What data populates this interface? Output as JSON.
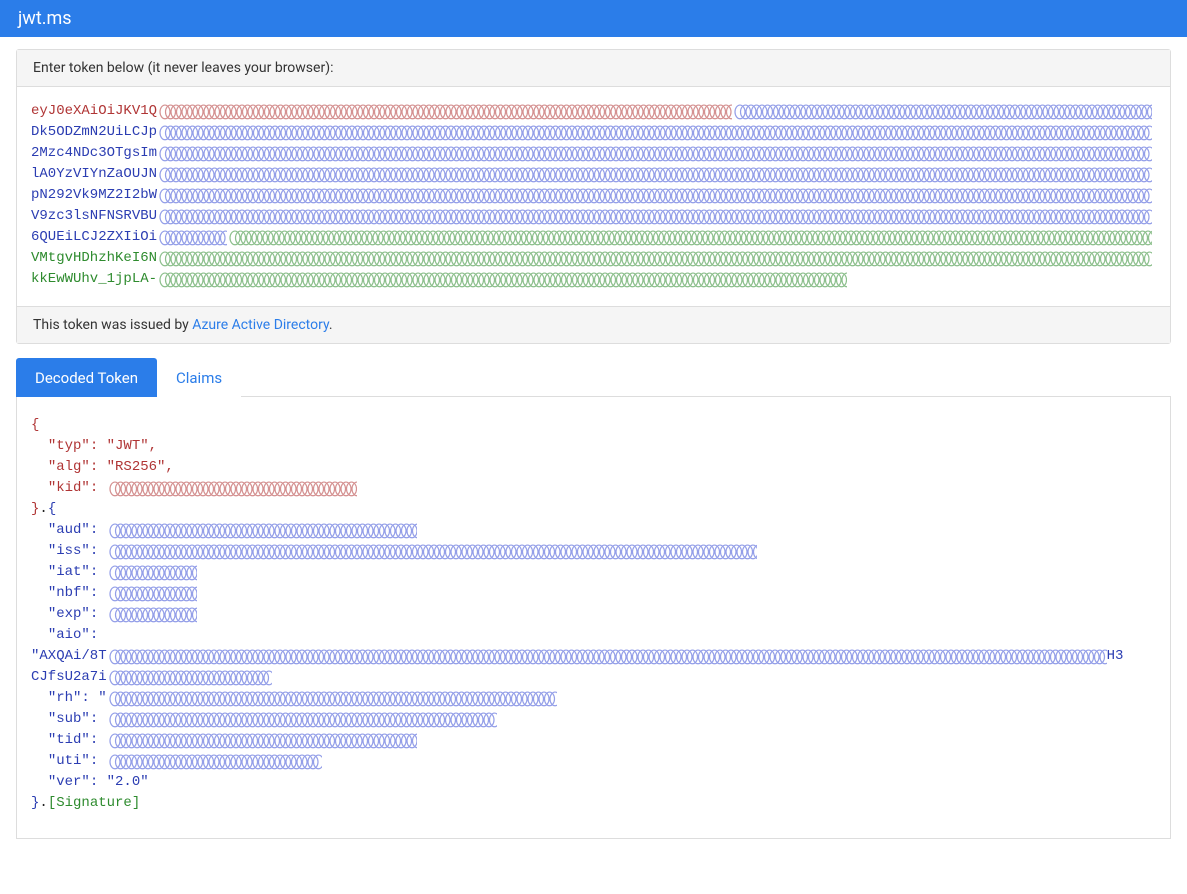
{
  "header": {
    "title": "jwt.ms"
  },
  "input_panel": {
    "label": "Enter token below (it never leaves your browser):"
  },
  "token_lines": [
    {
      "prefix": "eyJ0eXAiOiJKV1Q",
      "prefix_color": "red",
      "overlay_width": 575,
      "overlay_color": "red",
      "tail_width": 420,
      "tail_color": "blue"
    },
    {
      "prefix": "Dk5ODZmN2UiLCJp",
      "prefix_color": "blue",
      "overlay_width": 995,
      "overlay_color": "blue"
    },
    {
      "prefix": "2Mzc4NDc3OTgsIm",
      "prefix_color": "blue",
      "overlay_width": 995,
      "overlay_color": "blue"
    },
    {
      "prefix": "lA0YzVIYnZaOUJN",
      "prefix_color": "blue",
      "overlay_width": 995,
      "overlay_color": "blue"
    },
    {
      "prefix": "pN292Vk9MZ2I2bW",
      "prefix_color": "blue",
      "overlay_width": 995,
      "overlay_color": "blue"
    },
    {
      "prefix": "V9zc3lsNFNSRVBU",
      "prefix_color": "blue",
      "overlay_width": 995,
      "overlay_color": "blue"
    },
    {
      "prefix": "6QUEiLCJ2ZXIiOi",
      "prefix_color": "blue",
      "overlay_width": 70,
      "overlay_color": "blue",
      "tail_width": 925,
      "tail_color": "green"
    },
    {
      "prefix": "VMtgvHDhzhKeI6N",
      "prefix_color": "green",
      "overlay_width": 995,
      "overlay_color": "green"
    },
    {
      "prefix": "kkEwWUhv_1jpLA-",
      "prefix_color": "green",
      "overlay_width": 690,
      "overlay_color": "green"
    }
  ],
  "issuer": {
    "prefix": "This token was issued by ",
    "link_text": "Azure Active Directory",
    "suffix": "."
  },
  "tabs": {
    "decoded": "Decoded Token",
    "claims": "Claims",
    "active": "decoded"
  },
  "decoded": {
    "open_brace": "{",
    "header_lines": [
      {
        "key": "typ",
        "value": "\"JWT\",",
        "redacted": false
      },
      {
        "key": "alg",
        "value": "\"RS256\",",
        "redacted": false
      },
      {
        "key": "kid",
        "value": "",
        "redacted": true,
        "redact_width": 250
      }
    ],
    "mid_sep": "}.{",
    "payload_lines": [
      {
        "key": "aud",
        "redact_width": 310
      },
      {
        "key": "iss",
        "redact_width": 650
      },
      {
        "key": "iat",
        "redact_width": 90
      },
      {
        "key": "nbf",
        "redact_width": 90
      },
      {
        "key": "exp",
        "redact_width": 90
      },
      {
        "key": "aio",
        "redact_width": 0
      }
    ],
    "aio_line1": {
      "prefix": "\"AXQAi/8T",
      "redact_width": 1000,
      "suffix": "H3"
    },
    "aio_line2": {
      "prefix": "CJfsU2a7i",
      "redact_width": 165
    },
    "payload_lines2": [
      {
        "key": "rh",
        "prefix": "\"",
        "redact_width": 450
      },
      {
        "key": "sub",
        "redact_width": 390
      },
      {
        "key": "tid",
        "redact_width": 310
      },
      {
        "key": "uti",
        "redact_width": 215
      }
    ],
    "ver_line": {
      "key": "ver",
      "value": "\"2.0\""
    },
    "close_sep_prefix": "}",
    "close_sep_dot": ".",
    "signature_label": "[Signature]"
  },
  "colors": {
    "red": "#b03535",
    "blue": "#3b4fd6",
    "green": "#2e8b2e"
  }
}
